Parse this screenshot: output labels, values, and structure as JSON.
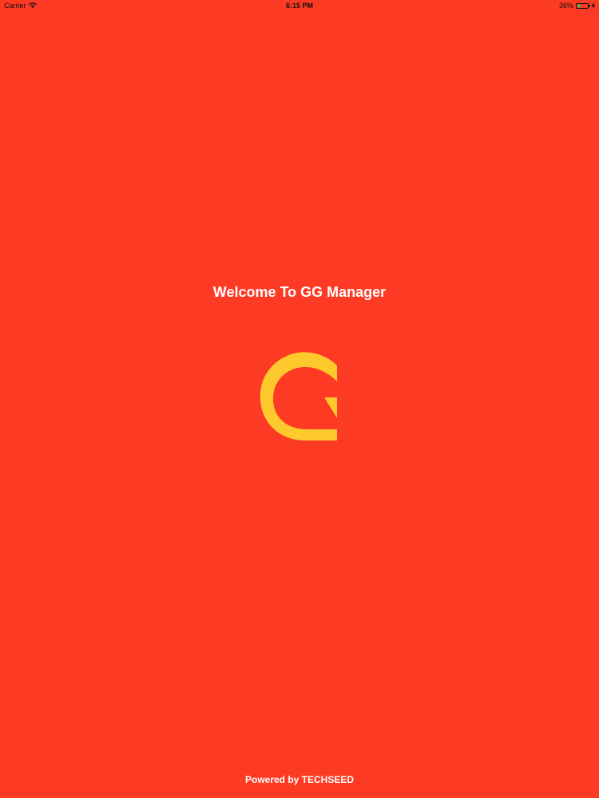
{
  "status_bar": {
    "carrier": "Carrier",
    "time": "6:15 PM",
    "battery_percent": "36%",
    "battery_level": 0.36
  },
  "welcome_text": "Welcome To GG Manager",
  "logo": {
    "icon": "g-logo-icon",
    "color": "#fdc92d"
  },
  "footer_text": "Powered by TECHSEED",
  "colors": {
    "background": "#fd3a23",
    "text": "#ffffff"
  }
}
